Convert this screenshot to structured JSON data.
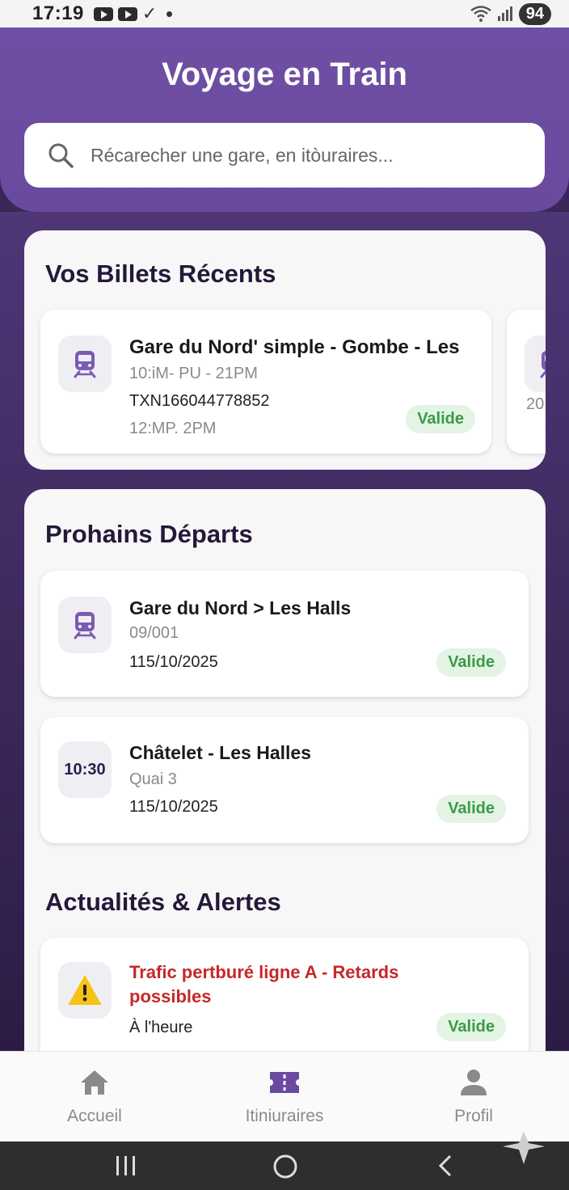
{
  "status_bar": {
    "time": "17:19",
    "battery": "94"
  },
  "header": {
    "title": "Voyage en Train",
    "search_placeholder": "Récarecher une gare, en itòuraires..."
  },
  "recent": {
    "title": "Vos Billets Récents",
    "tickets": [
      {
        "route": "Gare du Nord' simple - Gombe - Les",
        "time": "10:iM- PU - 21PM",
        "ref": "TXN166044778852",
        "time2": "12:MP. 2PM",
        "status": "Valide"
      }
    ],
    "partial_text": "20"
  },
  "departures": {
    "title": "Prohains Départs",
    "items": [
      {
        "route": "Gare du Nord > Les Halls",
        "sub": "09/001",
        "date": "115/10/2025",
        "status": "Valide"
      },
      {
        "time": "10:30",
        "route": "Châtelet - Les Halles",
        "sub": "Quai 3",
        "date": "115/10/2025",
        "status": "Valide"
      }
    ]
  },
  "alerts": {
    "title": "Actualités & Alertes",
    "items": [
      {
        "message": "Trafic pertburé ligne A - Retards possibles",
        "sub": "À l'heure",
        "status": "Valide"
      }
    ]
  },
  "bottom_nav": [
    {
      "label": "Accueil",
      "icon": "home-icon"
    },
    {
      "label": "Itiniuraires",
      "icon": "ticket-icon"
    },
    {
      "label": "Profil",
      "icon": "person-icon"
    }
  ],
  "colors": {
    "primary": "#6f4fa4",
    "valid_text": "#3b9b45",
    "valid_bg": "#e3f4e4",
    "alert": "#c62828"
  }
}
